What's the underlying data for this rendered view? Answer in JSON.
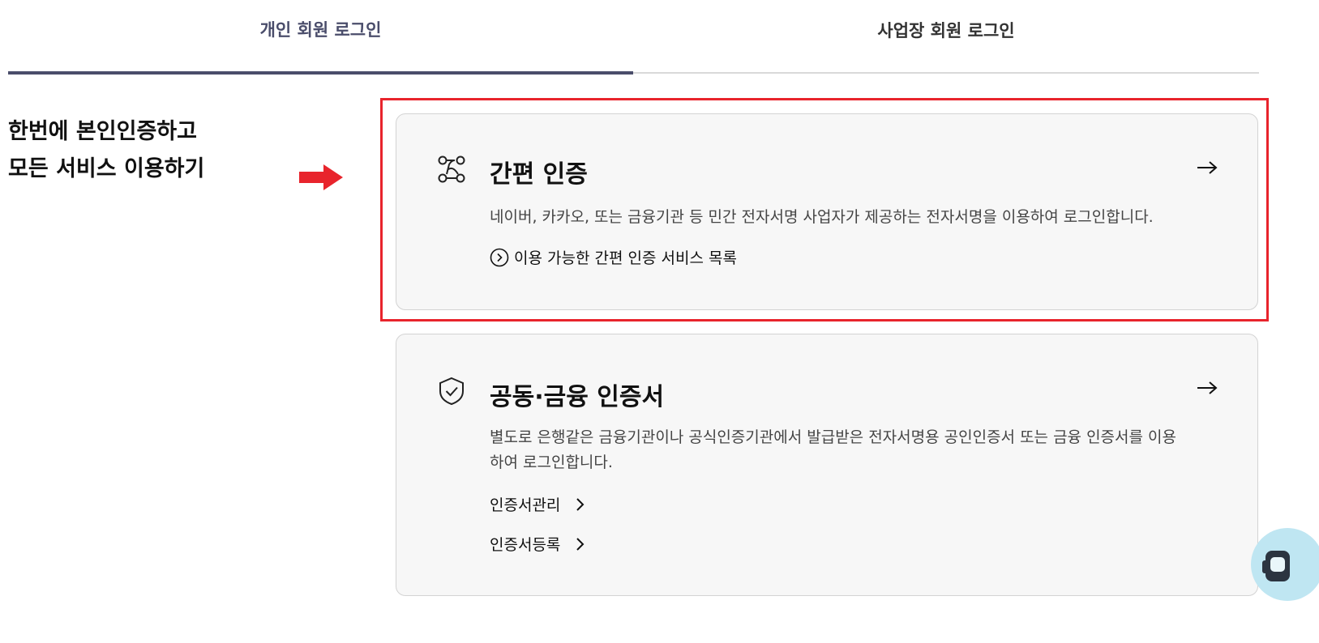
{
  "tabs": {
    "personal_label": "개인 회원 로그인",
    "business_label": "사업장 회원 로그인"
  },
  "headline": {
    "line1": "한번에 본인인증하고",
    "line2": "모든 서비스 이용하기"
  },
  "simple_auth": {
    "title": "간편 인증",
    "description": "네이버, 카카오, 또는 금융기관 등 민간 전자서명 사업자가 제공하는 전자서명을 이용하여 로그인합니다.",
    "services_link": "이용 가능한 간편 인증 서비스 목록"
  },
  "cert_auth": {
    "title": "공동·금융 인증서",
    "description": "별도로 은행같은 금융기관이나 공식인증기관에서 발급받은 전자서명용 공인인증서 또는 금융 인증서를 이용하여 로그인합니다.",
    "manage_link": "인증서관리",
    "register_link": "인증서등록"
  },
  "colors": {
    "active_tab": "#4a4d6b",
    "highlight": "#e8242c",
    "card_bg": "#f7f7f7"
  }
}
